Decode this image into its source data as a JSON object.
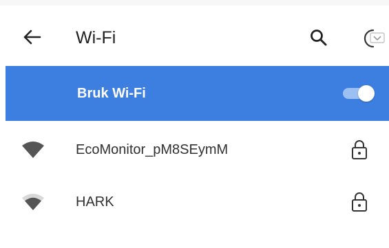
{
  "header": {
    "title": "Wi-Fi",
    "back_icon": "arrow-back-icon",
    "search_icon": "search-icon",
    "more_icon": "more-options-icon"
  },
  "wifi_toggle": {
    "label": "Bruk Wi-Fi",
    "state": "on",
    "background_color": "#3d7fe0"
  },
  "networks": [
    {
      "name": "EcoMonitor_pM8SEymM",
      "signal_icon": "wifi-signal-icon",
      "lock_icon": "lock-icon"
    },
    {
      "name": "HARK",
      "signal_icon": "wifi-signal-icon",
      "lock_icon": "lock-icon"
    }
  ]
}
